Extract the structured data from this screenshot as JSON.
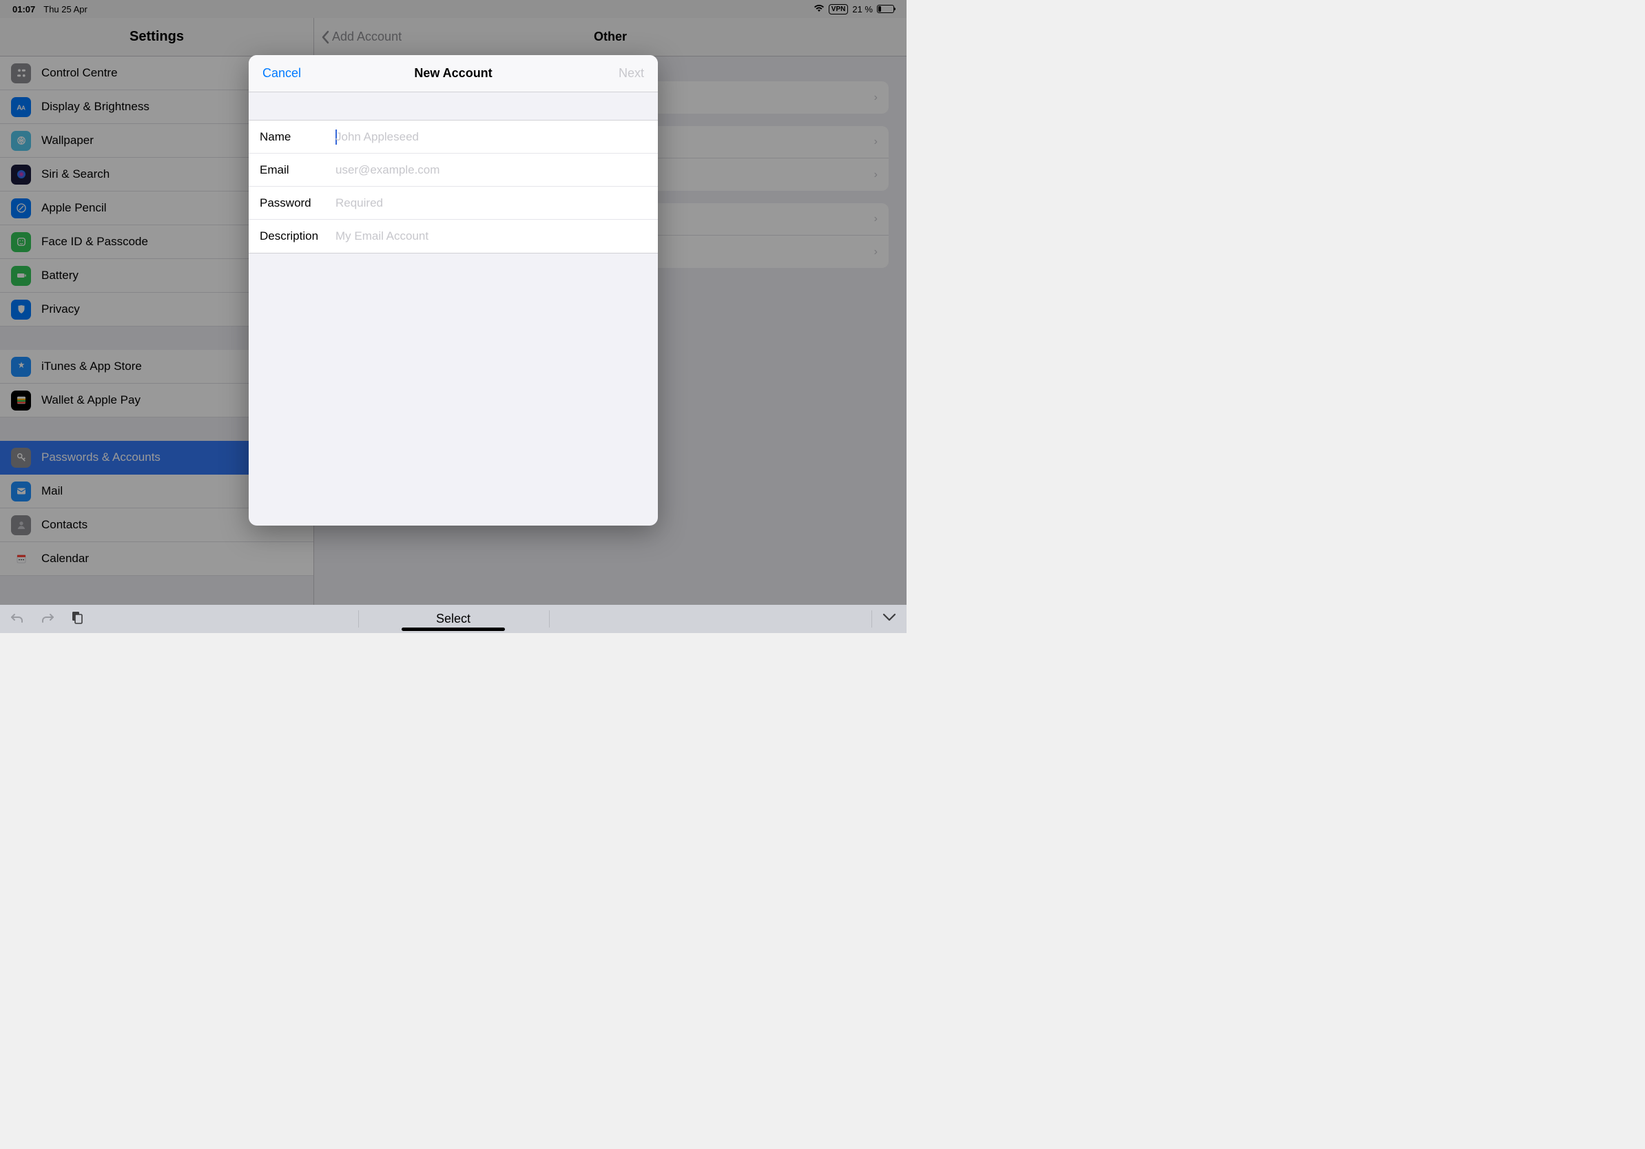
{
  "status": {
    "time": "01:07",
    "date": "Thu 25 Apr",
    "vpn": "VPN",
    "battery_pct": "21 %"
  },
  "sidebar": {
    "title": "Settings",
    "items": [
      {
        "label": "Control Centre",
        "icon": "control-centre",
        "color": "#8e8e93"
      },
      {
        "label": "Display & Brightness",
        "icon": "display",
        "color": "#007aff"
      },
      {
        "label": "Wallpaper",
        "icon": "wallpaper",
        "color": "#54c7ec"
      },
      {
        "label": "Siri & Search",
        "icon": "siri",
        "color": "#1c1c3c"
      },
      {
        "label": "Apple Pencil",
        "icon": "pencil",
        "color": "#007aff"
      },
      {
        "label": "Face ID & Passcode",
        "icon": "faceid",
        "color": "#34c759"
      },
      {
        "label": "Battery",
        "icon": "battery",
        "color": "#34c759"
      },
      {
        "label": "Privacy",
        "icon": "privacy",
        "color": "#007aff"
      }
    ],
    "group2": [
      {
        "label": "iTunes & App Store",
        "icon": "appstore",
        "color": "#1e90ff"
      },
      {
        "label": "Wallet & Apple Pay",
        "icon": "wallet",
        "color": "#000000"
      }
    ],
    "group3": [
      {
        "label": "Passwords & Accounts",
        "icon": "key",
        "color": "#8e8e93",
        "selected": true
      },
      {
        "label": "Mail",
        "icon": "mail",
        "color": "#1e90ff"
      },
      {
        "label": "Contacts",
        "icon": "contacts",
        "color": "#8e8e93"
      },
      {
        "label": "Calendar",
        "icon": "calendar",
        "color": "#ffffff"
      }
    ]
  },
  "detail": {
    "back": "Add Account",
    "title": "Other"
  },
  "modal": {
    "cancel": "Cancel",
    "title": "New Account",
    "next": "Next",
    "fields": {
      "name": {
        "label": "Name",
        "placeholder": "John Appleseed"
      },
      "email": {
        "label": "Email",
        "placeholder": "user@example.com"
      },
      "password": {
        "label": "Password",
        "placeholder": "Required"
      },
      "description": {
        "label": "Description",
        "placeholder": "My Email Account"
      }
    }
  },
  "kb": {
    "select": "Select"
  }
}
